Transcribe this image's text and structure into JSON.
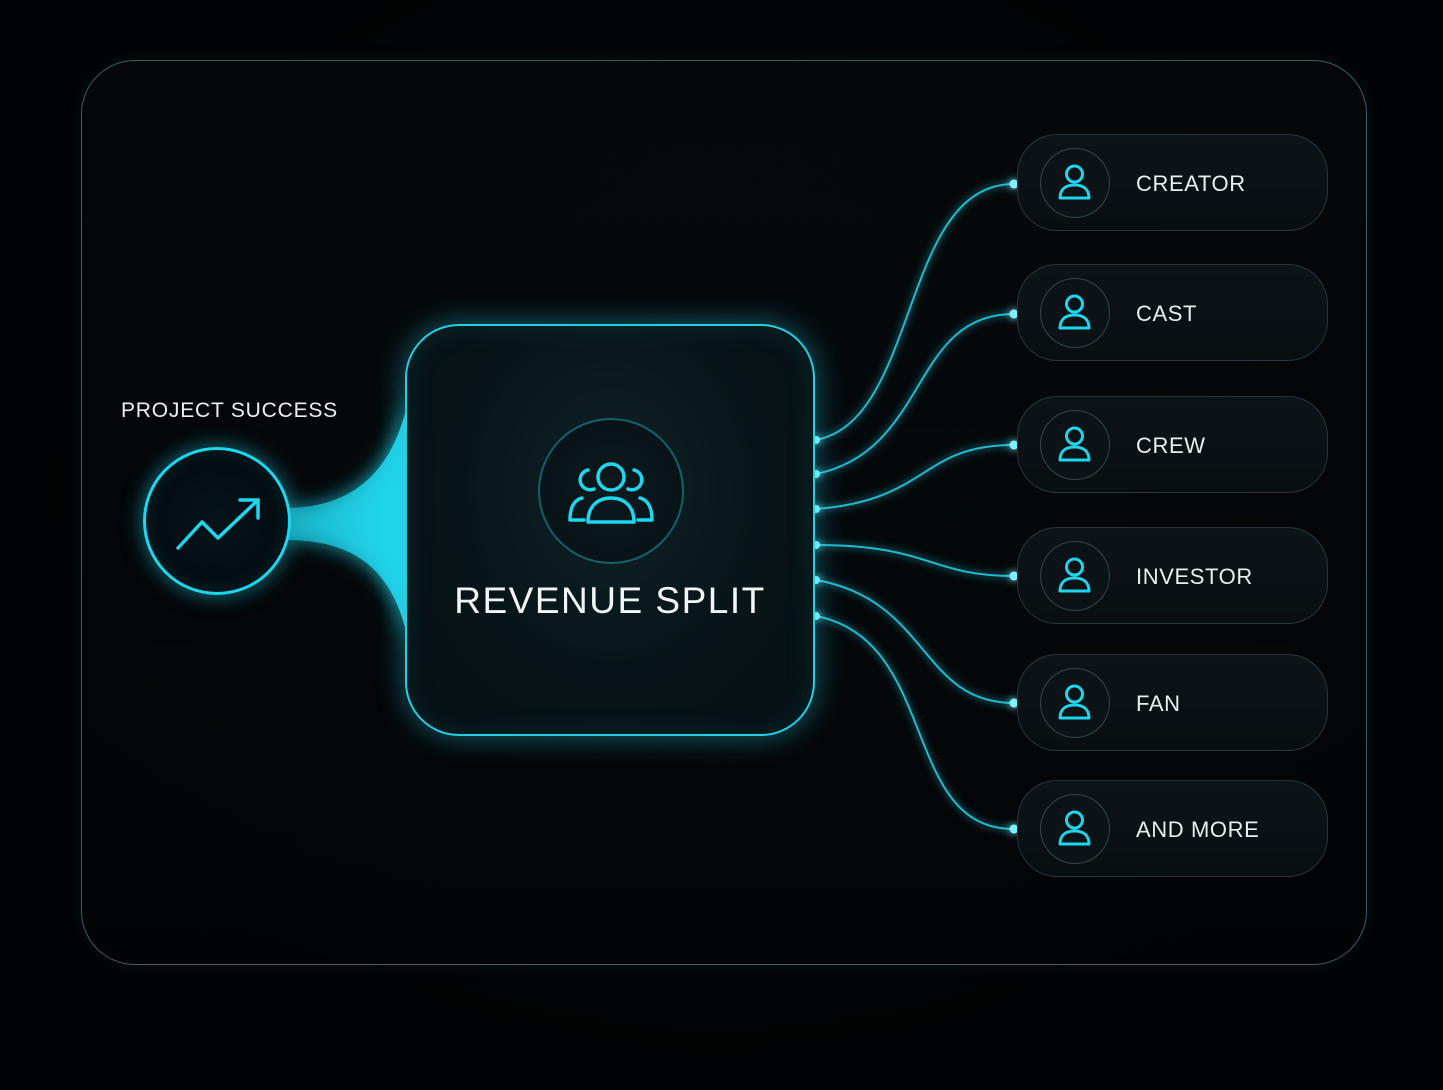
{
  "source": {
    "label": "PROJECT SUCCESS",
    "icon": "trending-up-icon"
  },
  "hub": {
    "title": "REVENUE SPLIT",
    "icon": "users-group-icon"
  },
  "recipients": [
    {
      "label": "CREATOR",
      "icon": "user-icon"
    },
    {
      "label": "CAST",
      "icon": "user-icon"
    },
    {
      "label": "CREW",
      "icon": "user-icon"
    },
    {
      "label": "INVESTOR",
      "icon": "user-icon"
    },
    {
      "label": "FAN",
      "icon": "user-icon"
    },
    {
      "label": "AND MORE",
      "icon": "user-icon"
    }
  ],
  "colors": {
    "accent": "#1ed6ee",
    "background": "#020304",
    "text": "#e9eef0"
  }
}
